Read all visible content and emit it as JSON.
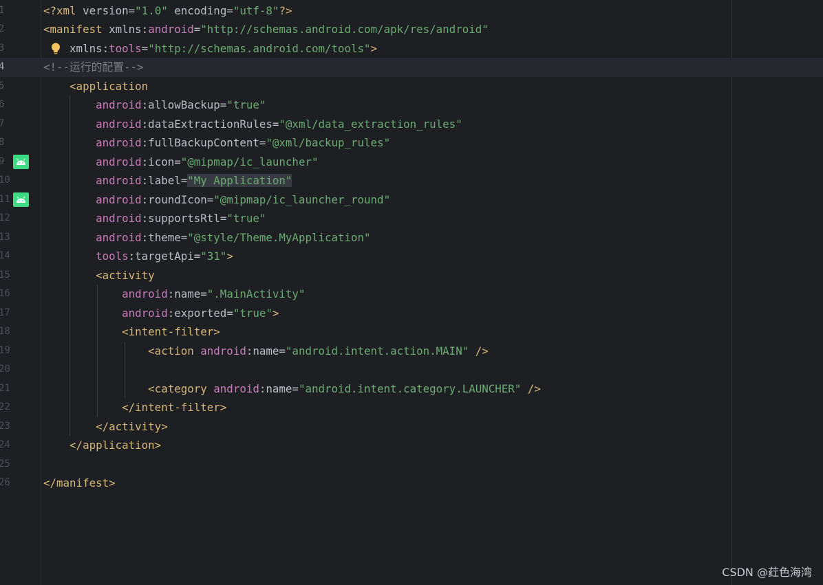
{
  "editor": {
    "lines": [
      {
        "n": "1",
        "tokens": [
          [
            "t-tag",
            "<?xml "
          ],
          [
            "t-attr",
            "version"
          ],
          [
            "t-eq",
            "="
          ],
          [
            "t-val",
            "\"1.0\""
          ],
          [
            "t-attr",
            " encoding"
          ],
          [
            "t-eq",
            "="
          ],
          [
            "t-val",
            "\"utf-8\""
          ],
          [
            "t-tag",
            "?>"
          ]
        ]
      },
      {
        "n": "2",
        "tokens": [
          [
            "t-tag",
            "<manifest "
          ],
          [
            "t-attr",
            "xmlns:"
          ],
          [
            "t-ns",
            "android"
          ],
          [
            "t-eq",
            "="
          ],
          [
            "t-val",
            "\"http://schemas.android.com/apk/res/android\""
          ]
        ]
      },
      {
        "n": "3",
        "tokens": [
          [
            "t-attr",
            "    xmlns:"
          ],
          [
            "t-ns",
            "tools"
          ],
          [
            "t-eq",
            "="
          ],
          [
            "t-val",
            "\"http://schemas.android.com/tools\""
          ],
          [
            "t-tag",
            ">"
          ]
        ],
        "bulb": true
      },
      {
        "n": "4",
        "tokens": [
          [
            "t-cmt",
            "<!--运行的配置-->"
          ]
        ],
        "current": true
      },
      {
        "n": "5",
        "tokens": [
          [
            "t-tag",
            "    <application"
          ]
        ]
      },
      {
        "n": "6",
        "tokens": [
          [
            "t-ns",
            "        android"
          ],
          [
            "t-attr",
            ":allowBackup"
          ],
          [
            "t-eq",
            "="
          ],
          [
            "t-val",
            "\"true\""
          ]
        ]
      },
      {
        "n": "7",
        "tokens": [
          [
            "t-ns",
            "        android"
          ],
          [
            "t-attr",
            ":dataExtractionRules"
          ],
          [
            "t-eq",
            "="
          ],
          [
            "t-val",
            "\"@xml/data_extraction_rules\""
          ]
        ]
      },
      {
        "n": "8",
        "tokens": [
          [
            "t-ns",
            "        android"
          ],
          [
            "t-attr",
            ":fullBackupContent"
          ],
          [
            "t-eq",
            "="
          ],
          [
            "t-val",
            "\"@xml/backup_rules\""
          ]
        ]
      },
      {
        "n": "9",
        "tokens": [
          [
            "t-ns",
            "        android"
          ],
          [
            "t-attr",
            ":icon"
          ],
          [
            "t-eq",
            "="
          ],
          [
            "t-val",
            "\"@mipmap/ic_launcher\""
          ]
        ],
        "android": true
      },
      {
        "n": "10",
        "tokens": [
          [
            "t-ns",
            "        android"
          ],
          [
            "t-attr",
            ":label"
          ],
          [
            "t-eq",
            "="
          ],
          [
            "t-val hl",
            "\"My Application\""
          ]
        ]
      },
      {
        "n": "11",
        "tokens": [
          [
            "t-ns",
            "        android"
          ],
          [
            "t-attr",
            ":roundIcon"
          ],
          [
            "t-eq",
            "="
          ],
          [
            "t-val",
            "\"@mipmap/ic_launcher_round\""
          ]
        ],
        "android": true
      },
      {
        "n": "12",
        "tokens": [
          [
            "t-ns",
            "        android"
          ],
          [
            "t-attr",
            ":supportsRtl"
          ],
          [
            "t-eq",
            "="
          ],
          [
            "t-val",
            "\"true\""
          ]
        ]
      },
      {
        "n": "13",
        "tokens": [
          [
            "t-ns",
            "        android"
          ],
          [
            "t-attr",
            ":theme"
          ],
          [
            "t-eq",
            "="
          ],
          [
            "t-val",
            "\"@style/Theme.MyApplication\""
          ]
        ]
      },
      {
        "n": "14",
        "tokens": [
          [
            "t-ns",
            "        tools"
          ],
          [
            "t-attr",
            ":targetApi"
          ],
          [
            "t-eq",
            "="
          ],
          [
            "t-val",
            "\"31\""
          ],
          [
            "t-tag",
            ">"
          ]
        ]
      },
      {
        "n": "15",
        "tokens": [
          [
            "t-tag",
            "        <activity"
          ]
        ]
      },
      {
        "n": "16",
        "tokens": [
          [
            "t-ns",
            "            android"
          ],
          [
            "t-attr",
            ":name"
          ],
          [
            "t-eq",
            "="
          ],
          [
            "t-val",
            "\".MainActivity\""
          ]
        ]
      },
      {
        "n": "17",
        "tokens": [
          [
            "t-ns",
            "            android"
          ],
          [
            "t-attr",
            ":exported"
          ],
          [
            "t-eq",
            "="
          ],
          [
            "t-val",
            "\"true\""
          ],
          [
            "t-tag",
            ">"
          ]
        ]
      },
      {
        "n": "18",
        "tokens": [
          [
            "t-tag",
            "            <intent-filter>"
          ]
        ]
      },
      {
        "n": "19",
        "tokens": [
          [
            "t-tag",
            "                <action "
          ],
          [
            "t-ns",
            "android"
          ],
          [
            "t-attr",
            ":name"
          ],
          [
            "t-eq",
            "="
          ],
          [
            "t-val",
            "\"android.intent.action.MAIN\""
          ],
          [
            "t-tag",
            " />"
          ]
        ]
      },
      {
        "n": "20",
        "tokens": []
      },
      {
        "n": "21",
        "tokens": [
          [
            "t-tag",
            "                <category "
          ],
          [
            "t-ns",
            "android"
          ],
          [
            "t-attr",
            ":name"
          ],
          [
            "t-eq",
            "="
          ],
          [
            "t-val",
            "\"android.intent.category.LAUNCHER\""
          ],
          [
            "t-tag",
            " />"
          ]
        ]
      },
      {
        "n": "22",
        "tokens": [
          [
            "t-tag",
            "            </intent-filter>"
          ]
        ]
      },
      {
        "n": "23",
        "tokens": [
          [
            "t-tag",
            "        </activity>"
          ]
        ]
      },
      {
        "n": "24",
        "tokens": [
          [
            "t-tag",
            "    </application>"
          ]
        ]
      },
      {
        "n": "25",
        "tokens": []
      },
      {
        "n": "26",
        "tokens": [
          [
            "t-tag",
            "</manifest>"
          ]
        ]
      }
    ]
  },
  "watermark": "CSDN @荭色海湾"
}
